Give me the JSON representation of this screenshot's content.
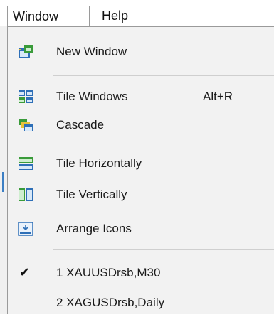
{
  "menubar": {
    "window_label": "Window",
    "help_label": "Help"
  },
  "menu": {
    "new_window": "New Window",
    "tile_windows": "Tile Windows",
    "tile_windows_shortcut": "Alt+R",
    "cascade": "Cascade",
    "tile_horizontally": "Tile Horizontally",
    "tile_vertically": "Tile Vertically",
    "arrange_icons": "Arrange Icons",
    "windows": [
      {
        "label": "1 XAUUSDrsb,M30",
        "checked": true
      },
      {
        "label": "2 XAGUSDrsb,Daily",
        "checked": false
      }
    ]
  },
  "icons": {
    "new_window": "new-window-icon",
    "tile_windows": "tile-windows-icon",
    "cascade": "cascade-icon",
    "tile_horizontally": "tile-horizontally-icon",
    "tile_vertically": "tile-vertically-icon",
    "arrange_icons": "arrange-icons-icon",
    "check": "checkmark-icon"
  },
  "colors": {
    "icon_blue": "#2e6fb7",
    "icon_green": "#3a9b3a",
    "icon_yellow": "#e8c23a",
    "menu_bg": "#f2f2f2"
  }
}
